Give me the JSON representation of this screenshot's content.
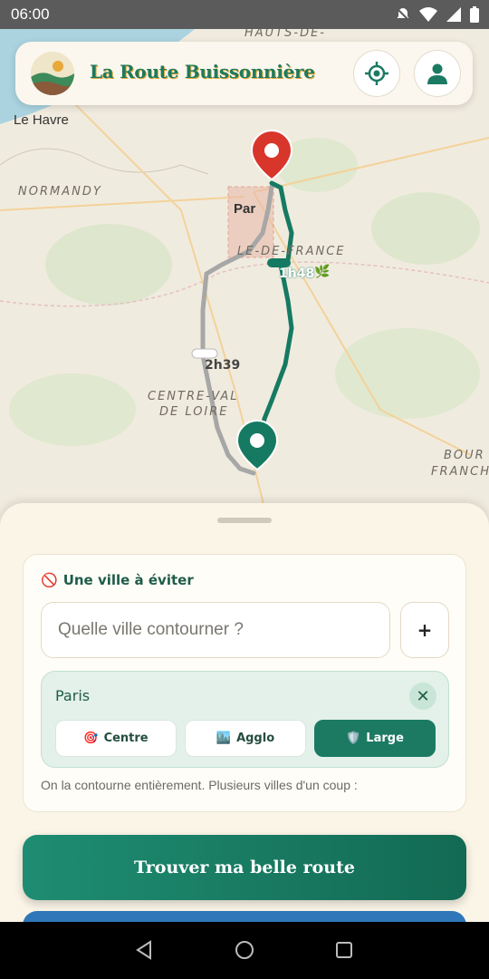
{
  "status_bar": {
    "time": "06:00"
  },
  "map": {
    "labels": {
      "hauts": "HAUTS-DE-",
      "normandy": "NORMANDY",
      "idf": "LE-DE-FRANCE",
      "centre1": "CENTRE-VAL",
      "centre2": "DE LOIRE",
      "bourg1": "BOUR",
      "bourg2": "FRANCH"
    },
    "cities": {
      "le_havre": "Le Havre",
      "paris": "Par"
    },
    "routes": {
      "alt_time": "2h39",
      "green_time": "1h48"
    }
  },
  "header": {
    "title": "La Route Buissonnière"
  },
  "avoid_card": {
    "title": "Une ville à éviter",
    "placeholder": "Quelle ville contourner ?",
    "add_label": "+",
    "city": {
      "name": "Paris",
      "options": [
        {
          "label": "Centre",
          "icon": "🎯",
          "selected": false
        },
        {
          "label": "Agglo",
          "icon": "🏙️",
          "selected": false
        },
        {
          "label": "Large",
          "icon": "🛡️",
          "selected": true
        }
      ]
    },
    "help": "On la contourne entièrement. Plusieurs villes d'un coup :"
  },
  "cta": {
    "label": "Trouver ma belle route"
  },
  "colors": {
    "accent": "#1c7a63",
    "marker_red": "#d9362b",
    "route_gray": "#a7a7a7"
  }
}
